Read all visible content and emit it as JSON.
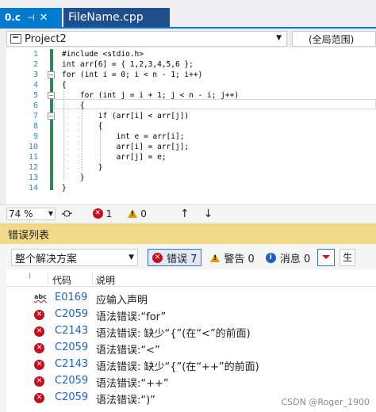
{
  "tabs": [
    {
      "label": "0.c",
      "pin": "⊣",
      "close": "✕"
    },
    {
      "label": "FileName.cpp"
    }
  ],
  "nav": {
    "project": "Project2",
    "scope": "(全局范围)"
  },
  "editor": {
    "line_numbers": [
      "1",
      "2",
      "3",
      "4",
      "5",
      "6",
      "7",
      "8",
      "9",
      "10",
      "11",
      "12",
      "13",
      "14"
    ],
    "lines": [
      "#include <stdio.h>",
      "int arr[6] = { 1,2,3,4,5,6 };",
      "for (int i = 0; i < n - 1; i++)",
      "{",
      "    for (int j = i + 1; j < n - i; j++)",
      "    {",
      "        if (arr[i] < arr[j])",
      "        {",
      "            int e = arr[i];",
      "            arr[i] = arr[j];",
      "            arr[j] = e;",
      "        }",
      "    }",
      "}"
    ]
  },
  "editor_status": {
    "zoom": "74 %",
    "errors": "1",
    "warnings": "0"
  },
  "error_list": {
    "title": "错误列表",
    "scope": "整个解决方案",
    "errors_label": "错误 7",
    "warnings_label": "警告 0",
    "messages_label": "消息 0",
    "truncated_select": "生",
    "columns": {
      "code": "代码",
      "desc": "说明"
    },
    "rows": [
      {
        "icon": "abc",
        "code": "E0169",
        "desc": "应输入声明"
      },
      {
        "icon": "error",
        "code": "C2059",
        "desc": "语法错误:“for”"
      },
      {
        "icon": "error",
        "code": "C2143",
        "desc": "语法错误: 缺少“{”(在“<”的前面)"
      },
      {
        "icon": "error",
        "code": "C2059",
        "desc": "语法错误:“<”"
      },
      {
        "icon": "error",
        "code": "C2143",
        "desc": "语法错误: 缺少“{”(在“++”的前面)"
      },
      {
        "icon": "error",
        "code": "C2059",
        "desc": "语法错误:“++”"
      },
      {
        "icon": "error",
        "code": "C2059",
        "desc": "语法错误:“)”"
      }
    ]
  },
  "watermark": "CSDN @Roger_1900",
  "colors": {
    "accent": "#007acc",
    "error": "#c50f1f",
    "warning": "#d99f00",
    "panel_title": "#f0d98a"
  }
}
